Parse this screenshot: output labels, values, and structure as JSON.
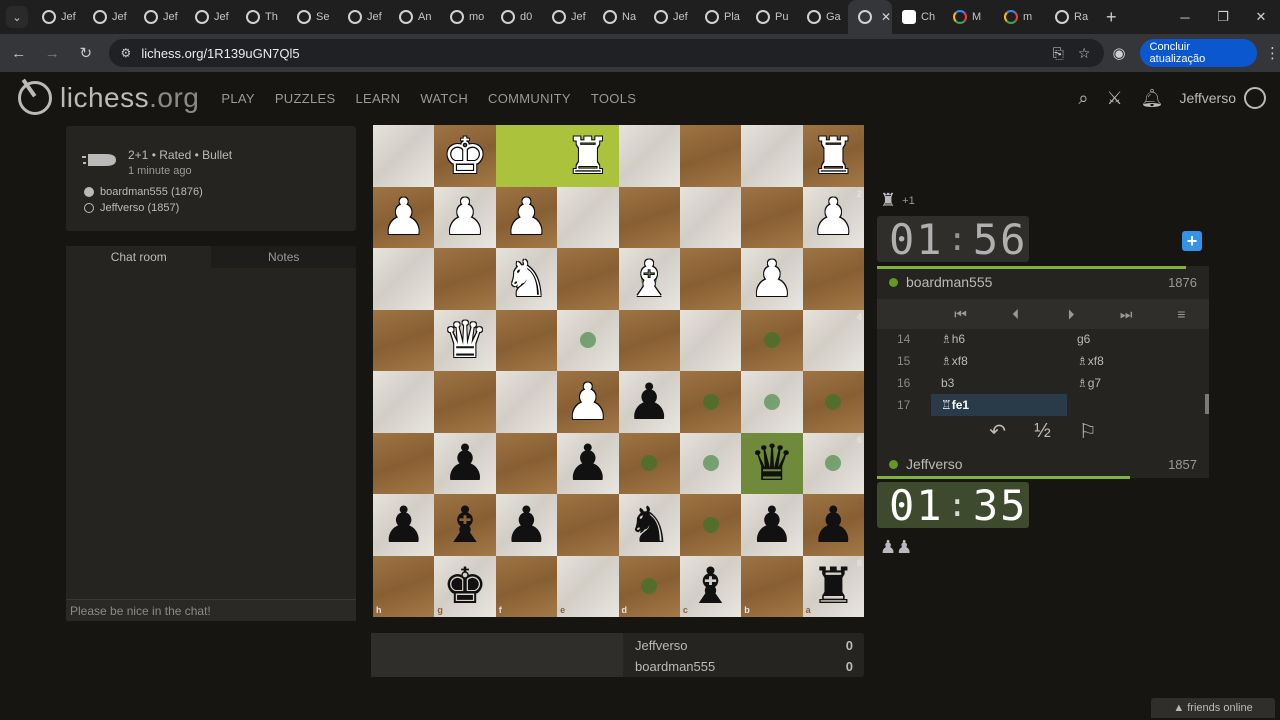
{
  "browser": {
    "tabs": [
      "Jef",
      "Jef",
      "Jef",
      "Jef",
      "Th",
      "Se",
      "Jef",
      "An",
      "mo",
      "d0",
      "Jef",
      "Na",
      "Jef",
      "Pla",
      "Pu",
      "Ga",
      "",
      "Ch",
      "M",
      "m",
      "Ra"
    ],
    "active_tab_index": 16,
    "url": "lichess.org/1R139uGN7Ql5",
    "update_button": "Concluir atualização"
  },
  "site": {
    "logo": "lichess",
    "logo_tld": ".org",
    "nav": [
      "PLAY",
      "PUZZLES",
      "LEARN",
      "WATCH",
      "COMMUNITY",
      "TOOLS"
    ],
    "username": "Jeffverso"
  },
  "game_info": {
    "line1": "2+1 • Rated • Bullet",
    "line2": "1 minute ago",
    "white_player": "boardman555 (1876)",
    "black_player": "Jeffverso (1857)"
  },
  "chat": {
    "tabs": [
      "Chat room",
      "Notes"
    ],
    "placeholder": "Please be nice in the chat!"
  },
  "board": {
    "ranks_labels": [
      "1",
      "2",
      "3",
      "4",
      "5",
      "6",
      "7",
      "8"
    ],
    "files_labels": [
      "h",
      "g",
      "f",
      "e",
      "d",
      "c",
      "b",
      "a"
    ],
    "pieces": [
      {
        "sq": "g1",
        "p": "♚",
        "c": "white"
      },
      {
        "sq": "e1",
        "p": "♜",
        "c": "white"
      },
      {
        "sq": "a1",
        "p": "♜",
        "c": "white"
      },
      {
        "sq": "h2",
        "p": "♟",
        "c": "white"
      },
      {
        "sq": "g2",
        "p": "♟",
        "c": "white"
      },
      {
        "sq": "f2",
        "p": "♟",
        "c": "white"
      },
      {
        "sq": "a2",
        "p": "♟",
        "c": "white"
      },
      {
        "sq": "f3",
        "p": "♞",
        "c": "white"
      },
      {
        "sq": "d3",
        "p": "♝",
        "c": "white"
      },
      {
        "sq": "b3",
        "p": "♟",
        "c": "white"
      },
      {
        "sq": "g4",
        "p": "♛",
        "c": "white"
      },
      {
        "sq": "e5",
        "p": "♟",
        "c": "white"
      },
      {
        "sq": "d5",
        "p": "♟",
        "c": "black"
      },
      {
        "sq": "g6",
        "p": "♟",
        "c": "black"
      },
      {
        "sq": "e6",
        "p": "♟",
        "c": "black"
      },
      {
        "sq": "b6",
        "p": "♛",
        "c": "black"
      },
      {
        "sq": "h7",
        "p": "♟",
        "c": "black"
      },
      {
        "sq": "g7",
        "p": "♝",
        "c": "black"
      },
      {
        "sq": "f7",
        "p": "♟",
        "c": "black"
      },
      {
        "sq": "d7",
        "p": "♞",
        "c": "black"
      },
      {
        "sq": "b7",
        "p": "♟",
        "c": "black"
      },
      {
        "sq": "a7",
        "p": "♟",
        "c": "black"
      },
      {
        "sq": "g8",
        "p": "♚",
        "c": "black"
      },
      {
        "sq": "c8",
        "p": "♝",
        "c": "black"
      },
      {
        "sq": "a8",
        "p": "♜",
        "c": "black"
      }
    ],
    "last_move": [
      "f1",
      "e1"
    ],
    "selected": "b6",
    "move_dots": [
      "d3",
      "e4",
      "b4",
      "c5",
      "b5",
      "a5",
      "d6",
      "c6",
      "a6",
      "c7",
      "d8"
    ],
    "highlight_color": "#aac23c"
  },
  "score": {
    "rows": [
      {
        "name": "Jeffverso",
        "score": "0"
      },
      {
        "name": "boardman555",
        "score": "0"
      }
    ]
  },
  "right": {
    "top_captured": "+1",
    "top_clock": {
      "min": "01",
      "sec": "56"
    },
    "top_user": {
      "name": "boardman555",
      "rating": "1876"
    },
    "moves": [
      {
        "n": "14",
        "w": "♗h6",
        "b": "g6"
      },
      {
        "n": "15",
        "w": "♗xf8",
        "b": "♗xf8"
      },
      {
        "n": "16",
        "w": "b3",
        "b": "♗g7"
      },
      {
        "n": "17",
        "w": "♖fe1",
        "b": ""
      }
    ],
    "bottom_user": {
      "name": "Jeffverso",
      "rating": "1857"
    },
    "bottom_clock": {
      "min": "01",
      "sec": "35"
    },
    "draw_label": "½"
  },
  "footer": {
    "friends": "▲ friends online"
  }
}
